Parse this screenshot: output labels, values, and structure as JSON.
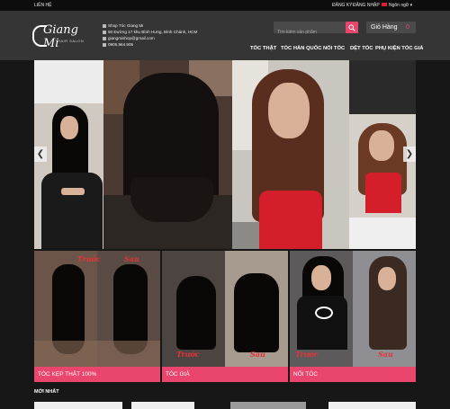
{
  "topbar": {
    "contact": "LIÊN HỆ",
    "register": "ĐĂNG KÝ",
    "login": "ĐĂNG NHẬP",
    "language": "Ngôn ngữ"
  },
  "brand": {
    "name": "Giang Mi",
    "tagline": "HAIR SALON"
  },
  "contact": {
    "shop": "Shop Tóc Giang Mi",
    "address": "50 Đường 17 khu Bình Hưng, Bình Chánh, HCM",
    "email": "giangmishop@gmail.com",
    "phone": "0905.964.905"
  },
  "search": {
    "placeholder": "Tìm kiếm sản phẩm"
  },
  "cart": {
    "label": "Giỏ Hàng",
    "count": "0"
  },
  "nav": [
    "TÓC THẬT",
    "TÓC HÀN QUỐC",
    "NỐI TÓC",
    "DỆT TÓC",
    "PHỤ KIỆN TÓC GIẢ"
  ],
  "slider": {
    "prev": "❮",
    "next": "❯"
  },
  "categories": [
    {
      "label": "TÓC KẸP THẬT 100%"
    },
    {
      "label": "TÓC GIẢ"
    },
    {
      "label": "NỐI TÓC"
    }
  ],
  "compare": {
    "before": "Trước",
    "after": "Sau"
  },
  "section_title": "MỚI NHẤT",
  "colors": {
    "accent": "#e9456d",
    "background": "#171717",
    "header": "#353535"
  }
}
